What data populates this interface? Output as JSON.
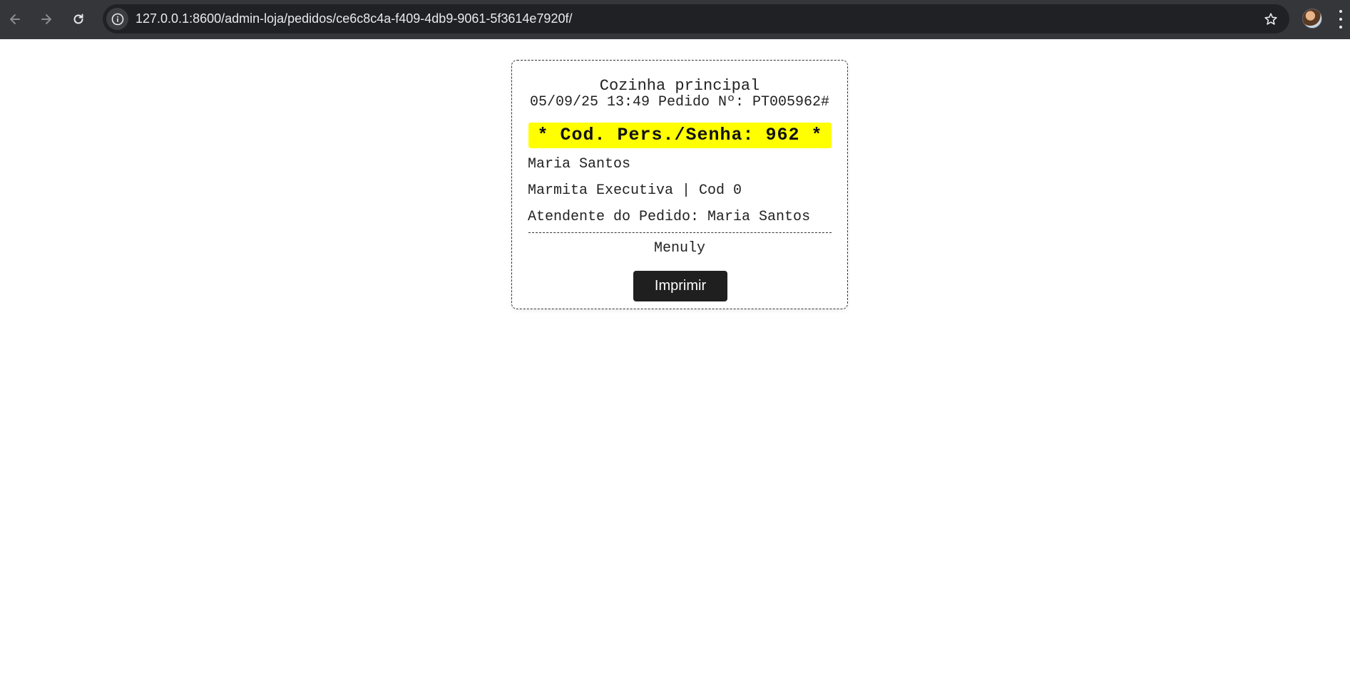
{
  "browser": {
    "url": "127.0.0.1:8600/admin-loja/pedidos/ce6c8c4a-f409-4db9-9061-5f3614e7920f/",
    "icons": {
      "back": "arrow-left-icon",
      "forward": "arrow-right-icon",
      "reload": "reload-icon",
      "site_info": "info-icon",
      "bookmark": "star-icon",
      "menu": "kebab-menu-icon"
    }
  },
  "ticket": {
    "station": "Cozinha principal",
    "meta": "05/09/25 13:49 Pedido Nº: PT005962#",
    "senha": "* Cod. Pers./Senha: 962 *",
    "customer_name": "Maria Santos",
    "item": "Marmita Executiva | Cod 0",
    "attendant": "Atendente do Pedido: Maria Santos",
    "brand": "Menuly",
    "print_label": "Imprimir"
  },
  "colors": {
    "highlight": "#ffff00",
    "button_bg": "#1f1f1f",
    "toolbar_bg": "#35363a"
  }
}
